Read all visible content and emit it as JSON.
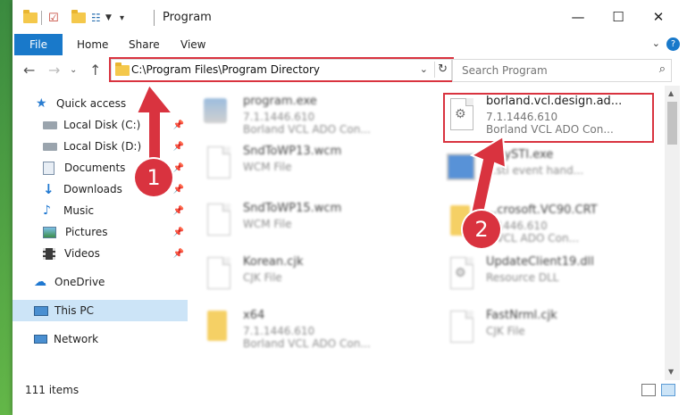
{
  "window": {
    "title": "Program",
    "controls": {
      "minimize": "—",
      "maximize": "☐",
      "close": "✕"
    }
  },
  "ribbon": {
    "tabs": [
      "File",
      "Home",
      "Share",
      "View"
    ],
    "help": "?"
  },
  "navigation": {
    "address": "C:\\Program Files\\Program Directory",
    "search_placeholder": "Search Program"
  },
  "sidebar": {
    "items": [
      {
        "label": "Quick access",
        "icon": "star-icon"
      },
      {
        "label": "Local Disk (C:)",
        "icon": "drive-icon",
        "pinned": true
      },
      {
        "label": "Local Disk (D:)",
        "icon": "drive-icon",
        "pinned": true
      },
      {
        "label": "Documents",
        "icon": "documents-icon",
        "pinned": true
      },
      {
        "label": "Downloads",
        "icon": "download-icon",
        "pinned": true
      },
      {
        "label": "Music",
        "icon": "music-icon",
        "pinned": true
      },
      {
        "label": "Pictures",
        "icon": "pictures-icon",
        "pinned": true
      },
      {
        "label": "Videos",
        "icon": "videos-icon",
        "pinned": true
      },
      {
        "label": "OneDrive",
        "icon": "cloud-icon"
      },
      {
        "label": "This PC",
        "icon": "computer-icon",
        "selected": true
      },
      {
        "label": "Network",
        "icon": "network-icon"
      }
    ]
  },
  "files": [
    {
      "name": "program.exe",
      "line1": "7.1.1446.610",
      "line2": "Borland VCL ADO Con..."
    },
    {
      "name": "borland.vcl.design.ad...",
      "line1": "7.1.1446.610",
      "line2": "Borland VCL ADO Con..."
    },
    {
      "name": "SndToWP13.wcm",
      "line1": "WCM File",
      "line2": ""
    },
    {
      "name": "...aySTI.exe",
      "line1": "...sti event hand...",
      "line2": ""
    },
    {
      "name": "SndToWP15.wcm",
      "line1": "WCM File",
      "line2": ""
    },
    {
      "name": "...crosoft.VC90.CRT",
      "line1": "...1446.610",
      "line2": "...VCL ADO Con..."
    },
    {
      "name": "Korean.cjk",
      "line1": "CJK File",
      "line2": ""
    },
    {
      "name": "UpdateClient19.dll",
      "line1": "Resource DLL",
      "line2": ""
    },
    {
      "name": "x64",
      "line1": "7.1.1446.610",
      "line2": "Borland VCL ADO Con..."
    },
    {
      "name": "FastNrml.cjk",
      "line1": "CJK File",
      "line2": ""
    }
  ],
  "status": {
    "count": "111 items"
  },
  "annotations": {
    "badge1": "1",
    "badge2": "2",
    "color": "#d9333f"
  }
}
